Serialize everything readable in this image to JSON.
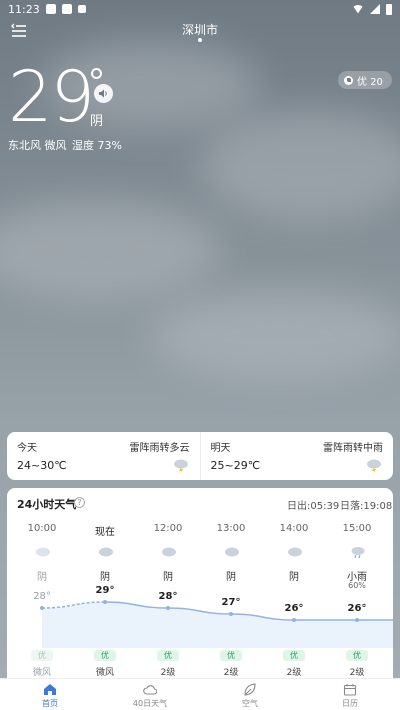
{
  "status_bar": {
    "time": "11:23"
  },
  "header": {
    "city": "深圳市"
  },
  "current": {
    "temperature": "29",
    "condition": "阴",
    "wind": "东北风 微风",
    "humidity": "湿度 73%",
    "aqi": "优 20"
  },
  "days": [
    {
      "name": "今天",
      "condition": "雷阵雨转多云",
      "range": "24~30℃",
      "icon": "thunder-rain-icon"
    },
    {
      "name": "明天",
      "condition": "雷阵雨转中雨",
      "range": "25~29℃",
      "icon": "thunder-rain-icon"
    }
  ],
  "hourly": {
    "title": "24小时天气",
    "sunrise": "日出:05:39",
    "sunset": "日落:19:08",
    "items": [
      {
        "time": "10:00",
        "condition": "阴",
        "prob": "",
        "temp": 28,
        "temp_label": "28°",
        "aqi": "优",
        "wind": "微风",
        "past": true,
        "icon": "cloud-icon"
      },
      {
        "time": "现在",
        "condition": "阴",
        "prob": "",
        "temp": 29,
        "temp_label": "29°",
        "aqi": "优",
        "wind": "微风",
        "past": false,
        "icon": "cloud-icon"
      },
      {
        "time": "12:00",
        "condition": "阴",
        "prob": "",
        "temp": 28,
        "temp_label": "28°",
        "aqi": "优",
        "wind": "2级",
        "past": false,
        "icon": "cloud-icon"
      },
      {
        "time": "13:00",
        "condition": "阴",
        "prob": "",
        "temp": 27,
        "temp_label": "27°",
        "aqi": "优",
        "wind": "2级",
        "past": false,
        "icon": "cloud-icon"
      },
      {
        "time": "14:00",
        "condition": "阴",
        "prob": "",
        "temp": 26,
        "temp_label": "26°",
        "aqi": "优",
        "wind": "2级",
        "past": false,
        "icon": "cloud-icon"
      },
      {
        "time": "15:00",
        "condition": "小雨",
        "prob": "60%",
        "temp": 26,
        "temp_label": "26°",
        "aqi": "优",
        "wind": "2级",
        "past": false,
        "icon": "light-rain-icon"
      }
    ]
  },
  "nav": [
    {
      "label": "首页",
      "icon": "home-icon",
      "active": true
    },
    {
      "label": "40日天气",
      "icon": "cloud-icon",
      "active": false
    },
    {
      "label": "空气",
      "icon": "leaf-icon",
      "active": false
    },
    {
      "label": "日历",
      "icon": "calendar-icon",
      "active": false
    }
  ],
  "colors": {
    "accent": "#3a7bd5",
    "aqi_good": "#2ca061",
    "curve": "#8fb3e6"
  }
}
